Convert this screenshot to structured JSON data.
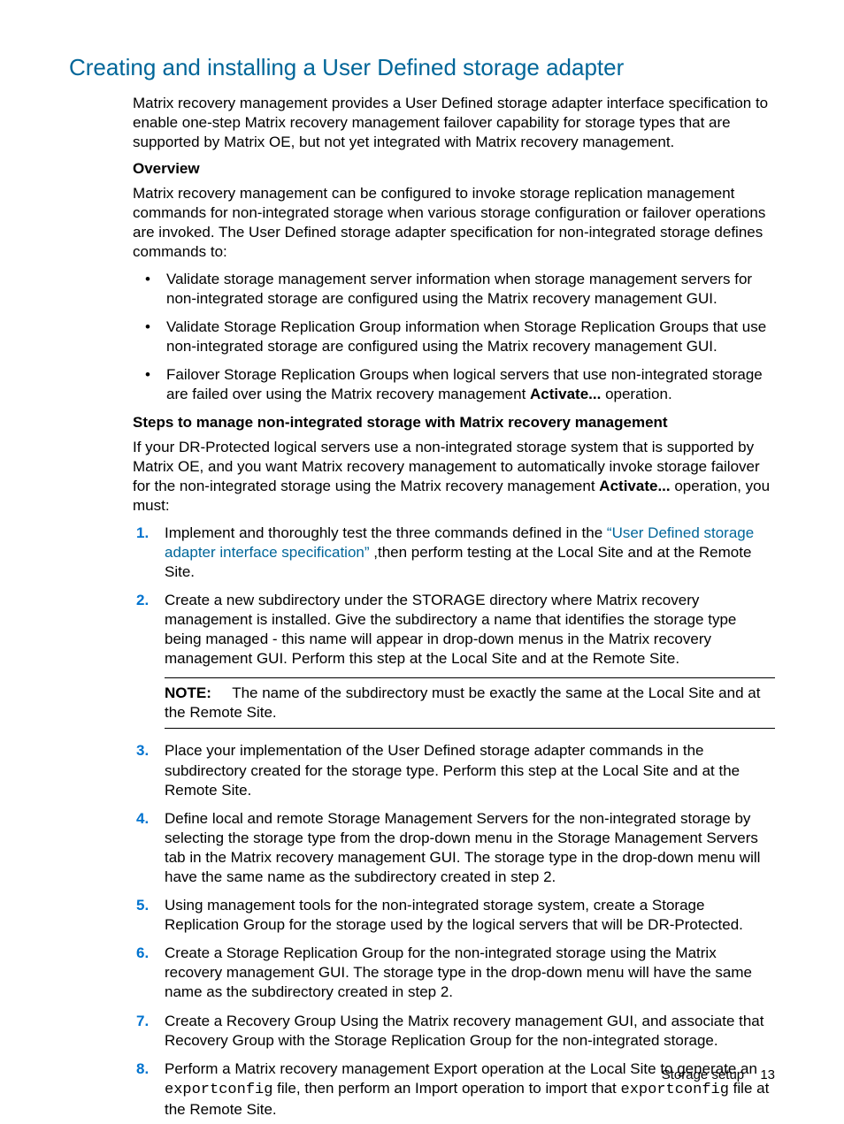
{
  "heading": "Creating and installing a User Defined storage adapter",
  "intro": "Matrix recovery management provides a User Defined storage adapter interface specification to enable one-step Matrix recovery management failover capability for storage types that are supported by Matrix OE, but not yet integrated with Matrix recovery management.",
  "overview": {
    "label": "Overview",
    "para": "Matrix recovery management can be configured to invoke storage replication management commands for non-integrated storage when various storage configuration or failover operations are invoked. The User Defined storage adapter specification for non-integrated storage defines commands to:",
    "bullets": [
      "Validate storage management server information when storage management servers for non-integrated storage are configured using the Matrix recovery management GUI.",
      "Validate Storage Replication Group information when Storage Replication Groups that use non-integrated storage are configured using the Matrix recovery management GUI.",
      {
        "pre": "Failover Storage Replication Groups when logical servers that use non-integrated storage are failed over using the Matrix recovery management ",
        "bold": "Activate...",
        "post": " operation."
      }
    ]
  },
  "steps_section": {
    "label": "Steps to manage non-integrated storage with Matrix recovery management",
    "intro_pre": "If your DR-Protected logical servers use a non-integrated storage system that is supported by Matrix OE, and you want Matrix recovery management to automatically invoke storage failover for the non-integrated storage using the Matrix recovery management ",
    "intro_bold": "Activate...",
    "intro_post": " operation, you must:",
    "items": [
      {
        "pre": "Implement and thoroughly test the three commands defined in the ",
        "link": "“User Defined storage adapter interface specification”",
        "post": " ,then perform testing at the Local Site and at the Remote Site."
      },
      "Create a new subdirectory under the STORAGE directory where Matrix recovery management is installed. Give the subdirectory a name that identifies the storage type being managed - this name will appear in drop-down menus in the Matrix recovery management GUI. Perform this step at the Local Site and at the Remote Site.",
      "Place your implementation of the User Defined storage adapter commands in the subdirectory created for the storage type. Perform this step at the Local Site and at the Remote Site.",
      "Define local and remote Storage Management Servers for the non-integrated storage by selecting the storage type from the drop-down menu in the Storage Management Servers tab in the Matrix recovery management GUI. The storage type in the drop-down menu will have the same name as the subdirectory created in step 2.",
      "Using management tools for the non-integrated storage system, create a Storage Replication Group for the storage used by the logical servers that will be DR-Protected.",
      "Create a Storage Replication Group for the non-integrated storage using the Matrix recovery management GUI. The storage type in the drop-down menu will have the same name as the subdirectory created in step 2.",
      "Create a Recovery Group Using the Matrix recovery management GUI, and associate that Recovery Group with the Storage Replication Group for the non-integrated storage.",
      {
        "pre": "Perform a Matrix recovery management Export operation at the Local Site to generate an ",
        "mono1": "exportconfig",
        "mid": " file, then perform an Import operation to import that ",
        "mono2": "exportconfig",
        "post": " file at the Remote Site."
      }
    ],
    "note": {
      "label": "NOTE:",
      "text": "The name of the subdirectory must be exactly the same at the Local Site and at the Remote Site."
    }
  },
  "footer": {
    "section": "Storage setup",
    "page": "13"
  }
}
